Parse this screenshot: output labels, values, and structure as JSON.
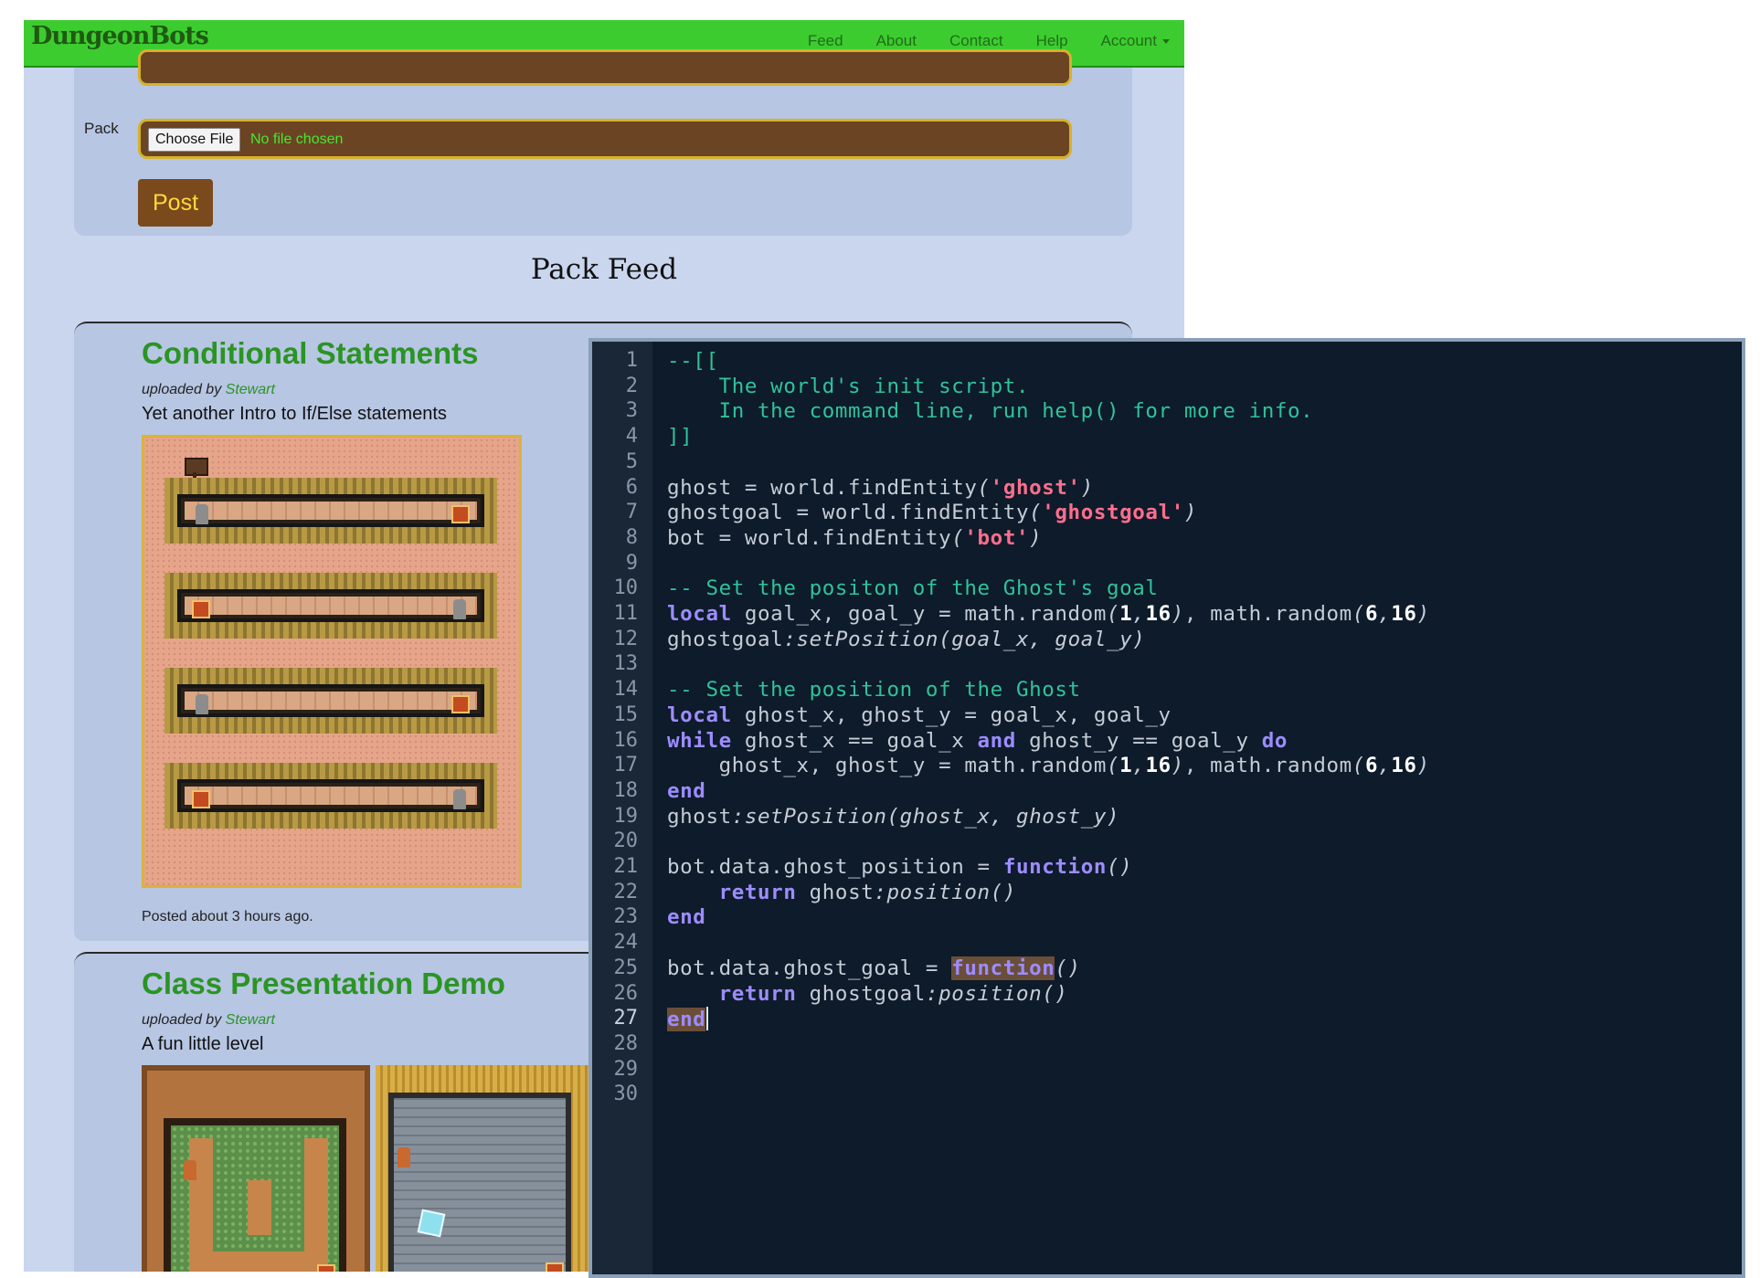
{
  "site": {
    "brand": "DungeonBots",
    "nav": [
      "Feed",
      "About",
      "Contact",
      "Help",
      "Account"
    ],
    "upload": {
      "pack_label": "Pack",
      "choose_file": "Choose File",
      "no_file": "No file chosen",
      "post_button": "Post"
    },
    "feed_title": "Pack Feed",
    "cards": [
      {
        "title": "Conditional Statements",
        "uploaded_by_prefix": "uploaded by",
        "user": "Stewart",
        "description": "Yet another Intro to If/Else statements",
        "posted": "Posted about 3 hours ago."
      },
      {
        "title": "Class Presentation Demo",
        "uploaded_by_prefix": "uploaded by",
        "user": "Stewart",
        "description": "A fun little level"
      }
    ]
  },
  "editor": {
    "line_numbers": [
      "1",
      "2",
      "3",
      "4",
      "5",
      "6",
      "7",
      "8",
      "9",
      "10",
      "11",
      "12",
      "13",
      "14",
      "15",
      "16",
      "17",
      "18",
      "19",
      "20",
      "21",
      "22",
      "23",
      "24",
      "25",
      "26",
      "27",
      "28",
      "29",
      "30"
    ],
    "active_line": "27",
    "colors": {
      "background": "#0d1b2a",
      "comment": "#2fc39b",
      "keyword": "#9d8cff",
      "string": "#ff6e8d"
    },
    "lines": [
      [
        {
          "t": "--[[",
          "c": "cm"
        }
      ],
      [
        {
          "t": "    The world's init script.",
          "c": "cm"
        }
      ],
      [
        {
          "t": "    In the command line, run help() for more info.",
          "c": "cm"
        }
      ],
      [
        {
          "t": "]]",
          "c": "cm"
        }
      ],
      [],
      [
        {
          "t": "ghost = world.findEntity"
        },
        {
          "t": "(",
          "c": "pn"
        },
        {
          "t": "'ghost'",
          "c": "str"
        },
        {
          "t": ")",
          "c": "pn"
        }
      ],
      [
        {
          "t": "ghostgoal = world.findEntity"
        },
        {
          "t": "(",
          "c": "pn"
        },
        {
          "t": "'ghostgoal'",
          "c": "str"
        },
        {
          "t": ")",
          "c": "pn"
        }
      ],
      [
        {
          "t": "bot = world.findEntity"
        },
        {
          "t": "(",
          "c": "pn"
        },
        {
          "t": "'bot'",
          "c": "str"
        },
        {
          "t": ")",
          "c": "pn"
        }
      ],
      [],
      [
        {
          "t": "-- Set the positon of the Ghost's goal",
          "c": "cm"
        }
      ],
      [
        {
          "t": "local",
          "c": "kw"
        },
        {
          "t": " goal_x, goal_y = math.random"
        },
        {
          "t": "(",
          "c": "pn"
        },
        {
          "t": "1",
          "c": "num"
        },
        {
          "t": ",",
          "c": "pn"
        },
        {
          "t": "16",
          "c": "num"
        },
        {
          "t": ")",
          "c": "pn"
        },
        {
          "t": ", math.random"
        },
        {
          "t": "(",
          "c": "pn"
        },
        {
          "t": "6",
          "c": "num"
        },
        {
          "t": ",",
          "c": "pn"
        },
        {
          "t": "16",
          "c": "num"
        },
        {
          "t": ")",
          "c": "pn"
        }
      ],
      [
        {
          "t": "ghostgoal"
        },
        {
          "t": ":setPosition",
          "c": "pn"
        },
        {
          "t": "(",
          "c": "pn"
        },
        {
          "t": "goal_x, goal_y",
          "c": "pn"
        },
        {
          "t": ")",
          "c": "pn"
        }
      ],
      [],
      [
        {
          "t": "-- Set the position of the Ghost",
          "c": "cm"
        }
      ],
      [
        {
          "t": "local",
          "c": "kw"
        },
        {
          "t": " ghost_x, ghost_y = goal_x, goal_y"
        }
      ],
      [
        {
          "t": "while",
          "c": "kw"
        },
        {
          "t": " ghost_x == goal_x "
        },
        {
          "t": "and",
          "c": "kw"
        },
        {
          "t": " ghost_y == goal_y "
        },
        {
          "t": "do",
          "c": "kw"
        }
      ],
      [
        {
          "t": "    ghost_x, ghost_y = math.random"
        },
        {
          "t": "(",
          "c": "pn"
        },
        {
          "t": "1",
          "c": "num"
        },
        {
          "t": ",",
          "c": "pn"
        },
        {
          "t": "16",
          "c": "num"
        },
        {
          "t": ")",
          "c": "pn"
        },
        {
          "t": ", math.random"
        },
        {
          "t": "(",
          "c": "pn"
        },
        {
          "t": "6",
          "c": "num"
        },
        {
          "t": ",",
          "c": "pn"
        },
        {
          "t": "16",
          "c": "num"
        },
        {
          "t": ")",
          "c": "pn"
        }
      ],
      [
        {
          "t": "end",
          "c": "kw"
        }
      ],
      [
        {
          "t": "ghost"
        },
        {
          "t": ":setPosition",
          "c": "pn"
        },
        {
          "t": "(",
          "c": "pn"
        },
        {
          "t": "ghost_x, ghost_y",
          "c": "pn"
        },
        {
          "t": ")",
          "c": "pn"
        }
      ],
      [],
      [
        {
          "t": "bot.data.ghost_position = "
        },
        {
          "t": "function",
          "c": "kw"
        },
        {
          "t": "()",
          "c": "pn"
        }
      ],
      [
        {
          "t": "    "
        },
        {
          "t": "return",
          "c": "kw"
        },
        {
          "t": " ghost"
        },
        {
          "t": ":position",
          "c": "pn"
        },
        {
          "t": "()",
          "c": "pn"
        }
      ],
      [
        {
          "t": "end",
          "c": "kw"
        }
      ],
      [],
      [
        {
          "t": "bot.data.ghost_goal = "
        },
        {
          "t": "function",
          "c": "kw hl"
        },
        {
          "t": "()",
          "c": "pn"
        }
      ],
      [
        {
          "t": "    "
        },
        {
          "t": "return",
          "c": "kw"
        },
        {
          "t": " ghostgoal"
        },
        {
          "t": ":position",
          "c": "pn"
        },
        {
          "t": "()",
          "c": "pn"
        }
      ],
      [
        {
          "t": "end",
          "c": "kw hl"
        },
        {
          "t": "",
          "c": "cursor"
        }
      ],
      [],
      [],
      []
    ]
  }
}
